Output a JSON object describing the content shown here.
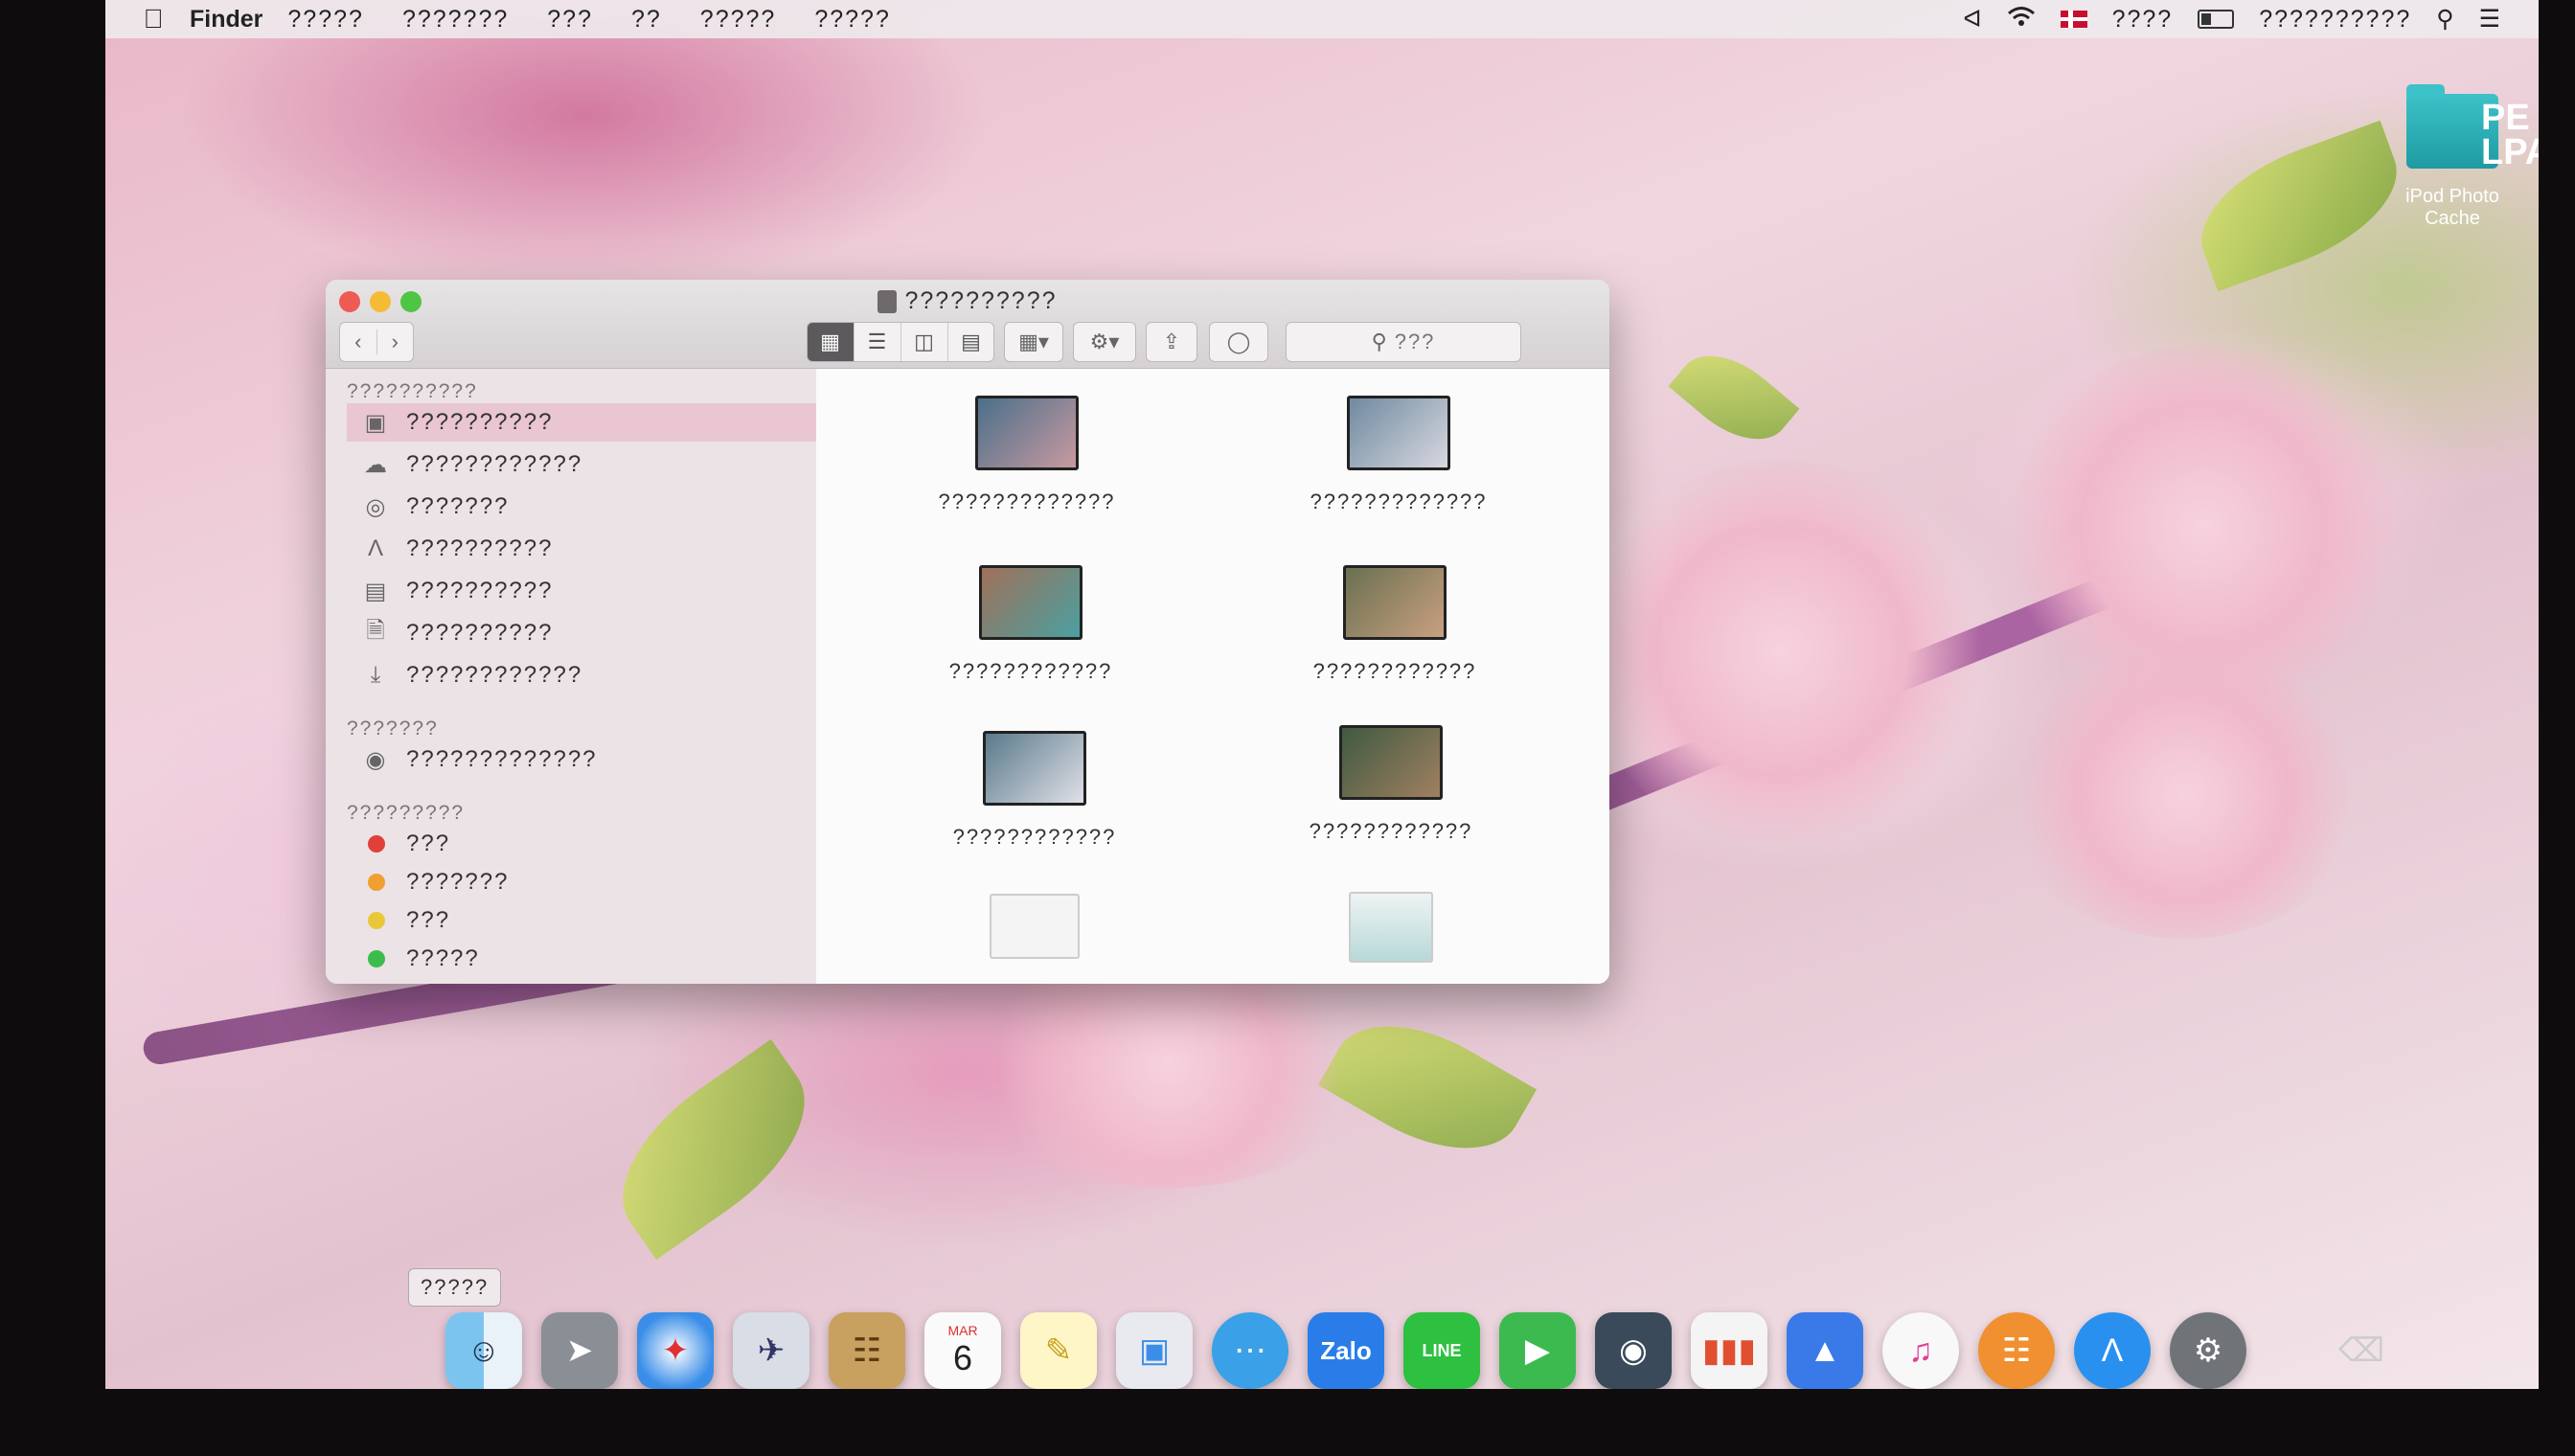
{
  "menubar": {
    "app_name": "Finder",
    "menus": [
      "?????",
      "???????",
      "???",
      "??",
      "?????",
      "?????"
    ],
    "status_text": "????",
    "datetime": "??????????"
  },
  "desktop": {
    "folder_label": "iPod Photo Cache",
    "folder_partial": "PE\nLPA"
  },
  "finder": {
    "title": "??????????",
    "search_placeholder": "???",
    "sidebar": {
      "favorites_header": "??????????",
      "favorites": [
        {
          "label": "??????????",
          "icon": "hard-drive-icon"
        },
        {
          "label": "????????????",
          "icon": "cloud-icon"
        },
        {
          "label": "???????",
          "icon": "airdrop-icon"
        },
        {
          "label": "??????????",
          "icon": "applications-icon"
        },
        {
          "label": "??????????",
          "icon": "desktop-icon"
        },
        {
          "label": "??????????",
          "icon": "documents-icon"
        },
        {
          "label": "????????????",
          "icon": "downloads-icon"
        }
      ],
      "devices_header": "???????",
      "devices": [
        {
          "label": "?????????????",
          "icon": "disc-icon"
        }
      ],
      "tags_header": "?????????",
      "tags": [
        {
          "label": "???",
          "color": "#e0403a"
        },
        {
          "label": "???????",
          "color": "#f0a030"
        },
        {
          "label": "???",
          "color": "#e8c838"
        },
        {
          "label": "?????",
          "color": "#3cbc4c"
        }
      ]
    },
    "files": [
      {
        "name": "?????????????",
        "thumb": "#4a6f8a"
      },
      {
        "name": "?????????????",
        "thumb": "#6f8aa0"
      },
      {
        "name": "????????????",
        "thumb": "#a0705a"
      },
      {
        "name": "????????????",
        "thumb": "#6a7050"
      },
      {
        "name": "????????????",
        "thumb": "#5a7a8a"
      },
      {
        "name": "????????????",
        "thumb": "#3f5a40"
      }
    ]
  },
  "dock": {
    "tooltip": "?????",
    "calendar_month": "MAR",
    "calendar_day": "6",
    "zalo_label": "Zalo",
    "line_label": "LINE"
  }
}
